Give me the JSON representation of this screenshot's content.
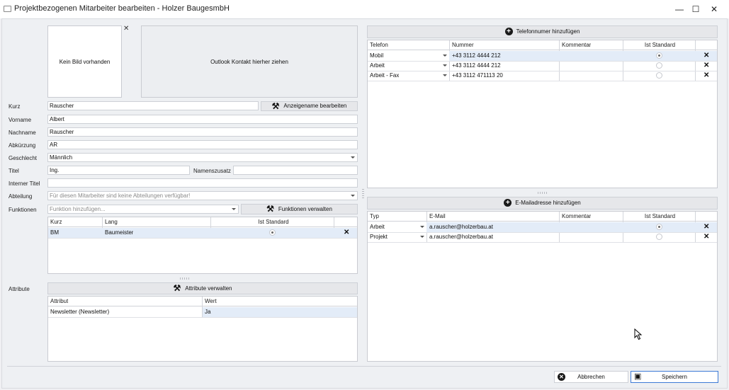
{
  "window": {
    "title": "Projektbezogenen Mitarbeiter bearbeiten - Holzer BaugesmbH",
    "minimize": "—",
    "maximize": "☐",
    "close": "✕"
  },
  "photo": {
    "text": "Kein Bild vorhanden",
    "remove": "✕"
  },
  "outlook": {
    "text": "Outlook Kontakt hierher ziehen"
  },
  "labels": {
    "kurz": "Kurz",
    "vorname": "Vorname",
    "nachname": "Nachname",
    "abkuerzung": "Abkürzung",
    "geschlecht": "Geschlecht",
    "titel": "Titel",
    "namenszusatz": "Namenszusatz",
    "interner_titel": "Interner Titel",
    "abteilung": "Abteilung",
    "funktionen": "Funktionen",
    "attribute": "Attribute"
  },
  "fields": {
    "kurz": "Rauscher",
    "vorname": "Albert",
    "nachname": "Rauscher",
    "abkuerzung": "AR",
    "geschlecht": "Männlich",
    "titel": "Ing.",
    "namenszusatz": "",
    "interner_titel": "",
    "abteilung_placeholder": "Für diesen Mitarbeiter sind keine Abteilungen verfügbar!",
    "funktion_placeholder": "Funktion hinzufügen..."
  },
  "buttons": {
    "anzeigename": "Anzeigename bearbeiten",
    "funktionen_verwalten": "Funktionen verwalten",
    "attribute_verwalten": "Attribute verwalten",
    "telefon_add": "Telefonnumer hinzufügen",
    "email_add": "E-Mailadresse hinzufügen",
    "abbrechen": "Abbrechen",
    "speichern": "Speichern"
  },
  "funktionen_table": {
    "headers": [
      "Kurz",
      "Lang",
      "Ist Standard"
    ],
    "rows": [
      {
        "kurz": "BM",
        "lang": "Baumeister",
        "standard": true
      }
    ]
  },
  "attribute_table": {
    "headers": [
      "Attribut",
      "Wert"
    ],
    "rows": [
      {
        "attribut": "Newsletter (Newsletter)",
        "wert": "Ja"
      }
    ]
  },
  "telefon_table": {
    "headers": [
      "Telefon",
      "Nummer",
      "Kommentar",
      "Ist Standard"
    ],
    "rows": [
      {
        "typ": "Mobil",
        "nummer": "+43 3112 4444 212",
        "kommentar": "",
        "standard": true
      },
      {
        "typ": "Arbeit",
        "nummer": "+43 3112 4444 212",
        "kommentar": "",
        "standard": false
      },
      {
        "typ": "Arbeit - Fax",
        "nummer": "+43 3112 471113 20",
        "kommentar": "",
        "standard": false
      }
    ]
  },
  "email_table": {
    "headers": [
      "Typ",
      "E-Mail",
      "Kommentar",
      "Ist Standard"
    ],
    "rows": [
      {
        "typ": "Arbeit",
        "email": "a.rauscher@holzerbau.at",
        "kommentar": "",
        "standard": true
      },
      {
        "typ": "Projekt",
        "email": "a.rauscher@holzerbau.at",
        "kommentar": "",
        "standard": false
      }
    ]
  },
  "icons": {
    "remove_row": "✕",
    "plus": "+",
    "tools": "⚒",
    "cancel": "✕",
    "save": "▣"
  }
}
